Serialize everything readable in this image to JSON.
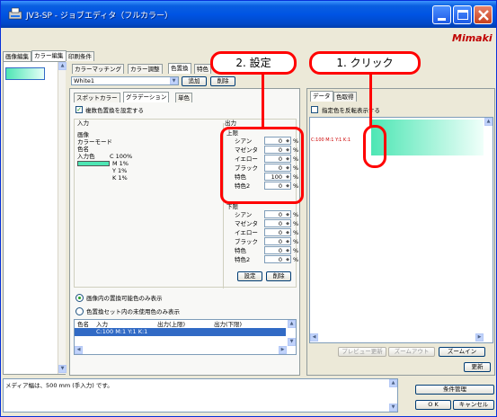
{
  "window": {
    "title": "JV3-SP - ジョブエディタ（フルカラー）",
    "brand": "Mimaki"
  },
  "left_tabs": [
    "画像編集",
    "カラー編集",
    "印刷条件"
  ],
  "color_tabs": [
    "カラーマッチング",
    "カラー調整",
    "色置換",
    "特色"
  ],
  "entry": {
    "value": "White1",
    "add_label": "追加",
    "delete_label": "削除"
  },
  "sub_tabs": [
    "スポットカラー",
    "グラデーション",
    "単色"
  ],
  "multi_color_checkbox": {
    "label": "複数色置換を設定する",
    "checked": true
  },
  "input_group": {
    "title": "入力",
    "labels": [
      "画像",
      "カラーモード",
      "色名",
      "入力色"
    ],
    "values": [
      "C 100%",
      "M 1%",
      "Y 1%",
      "K 1%"
    ],
    "swatch_color": "#4ee6b4"
  },
  "output_group": {
    "title": "出力",
    "upper_label": "上限",
    "lower_label": "下限",
    "channels": [
      "シアン",
      "マゼンタ",
      "イエロー",
      "ブラック",
      "特色",
      "特色2"
    ],
    "upper_values": [
      "0",
      "0",
      "0",
      "0",
      "100",
      "0"
    ],
    "lower_values": [
      "0",
      "0",
      "0",
      "0",
      "0",
      "0"
    ],
    "unit": "%",
    "set_label": "設定",
    "delete_label": "削除"
  },
  "radios": [
    "画像内の置換可能色のみ表示",
    "色置換セット内の未使用色のみ表示"
  ],
  "table": {
    "headers": [
      "色名",
      "入力",
      "出力(上限)",
      "出力(下限)"
    ],
    "row": "C:100 M:1 Y:1 K:1"
  },
  "preview": {
    "tabs": [
      "データ",
      "色取得"
    ],
    "checkbox_label": "指定色を反転表示する",
    "color_readout": "C:100  M:1  Y:1  K:1",
    "preview_update": "プレビュー更新",
    "zoom_out": "ズームアウト",
    "zoom_in": "ズームイン",
    "refresh": "更新"
  },
  "callouts": {
    "step1": "1. クリック",
    "step2": "2. 設定"
  },
  "status": {
    "message": "メディア幅は、500 mm (手入力) です。",
    "condition_label": "条件管理",
    "ok_label": "O K",
    "cancel_label": "キャンセル"
  },
  "colors": {
    "titlebar": "#0054e3",
    "callout": "#ff0000",
    "accent_green": "#4ee6b4",
    "selection": "#316ac5"
  }
}
